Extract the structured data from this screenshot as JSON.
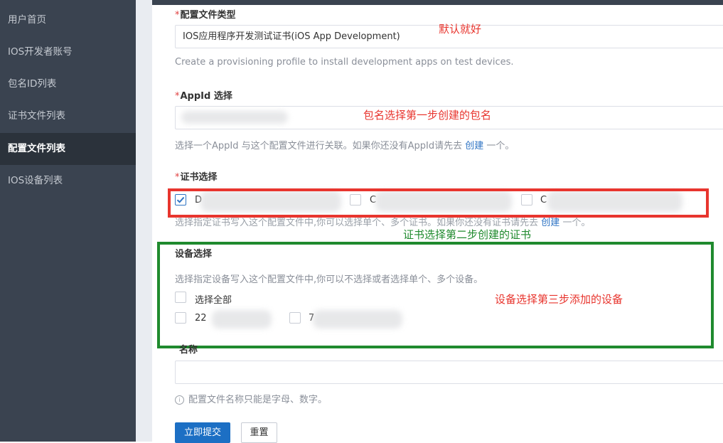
{
  "sidebar": {
    "items": [
      {
        "label": "用户首页"
      },
      {
        "label": "IOS开发者账号"
      },
      {
        "label": "包名ID列表"
      },
      {
        "label": "证书文件列表"
      },
      {
        "label": "配置文件列表",
        "active": true
      },
      {
        "label": "IOS设备列表"
      }
    ]
  },
  "form": {
    "profile_type": {
      "required_mark": "*",
      "label": "配置文件类型",
      "value": "IOS应用程序开发测试证书(iOS App Development)",
      "help": "Create a provisioning profile to install development apps on test devices."
    },
    "appid": {
      "required_mark": "*",
      "label": "AppId 选择",
      "help_prefix": "选择一个AppId 与这个配置文件进行关联。如果你还没有AppId请先去",
      "help_link": "创建",
      "help_suffix": "一个。"
    },
    "certificate": {
      "required_mark": "*",
      "label": "证书选择",
      "options": [
        {
          "label": "D",
          "checked": true
        },
        {
          "label": "C",
          "checked": false
        },
        {
          "label": "C",
          "checked": false
        }
      ],
      "help_prefix": "选择指定证书写入这个配置文件中,你可以选择单个、多个证书。如果你还没有证书请先去",
      "help_link": "创建",
      "help_suffix": "一个。"
    },
    "devices": {
      "label": "设备选择",
      "help": "选择指定设备写入这个配置文件中,你可以不选择或者选择单个、多个设备。",
      "select_all": "选择全部",
      "options": [
        {
          "label": "22",
          "checked": false
        },
        {
          "label": "7",
          "checked": false
        }
      ]
    },
    "name": {
      "label": "名称",
      "value": "",
      "help": "配置文件名称只能是字母、数字。"
    },
    "submit_label": "立即提交",
    "reset_label": "重置"
  },
  "annotations": {
    "default_ok": "默认就好",
    "appid_note": "包名选择第一步创建的包名",
    "cert_note": "证书选择第二步创建的证书",
    "device_note": "设备选择第三步添加的设备"
  },
  "colors": {
    "sidebar_bg": "#3a4350",
    "accent": "#1c6fc4",
    "annotation_red": "#e8352e",
    "annotation_green": "#1f8a2e"
  }
}
